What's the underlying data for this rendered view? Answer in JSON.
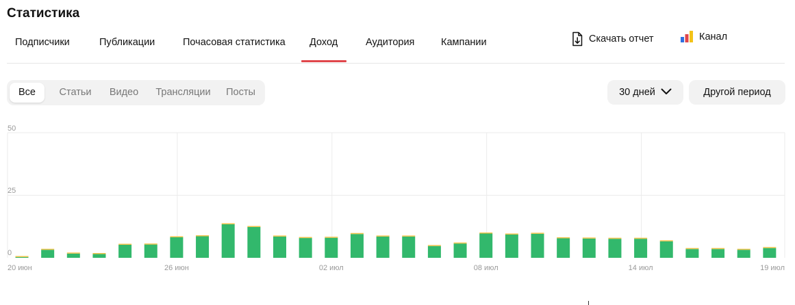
{
  "page": {
    "title": "Статистика"
  },
  "tabs": [
    {
      "label": "Подписчики",
      "active": false
    },
    {
      "label": "Публикации",
      "active": false
    },
    {
      "label": "Почасовая статистика",
      "active": false
    },
    {
      "label": "Доход",
      "active": true
    },
    {
      "label": "Аудитория",
      "active": false
    },
    {
      "label": "Кампании",
      "active": false
    }
  ],
  "actions": {
    "download_report": {
      "label": "Скачать отчет",
      "icon": "download-file-icon"
    },
    "channel": {
      "label": "Канал",
      "icon": "bar-chart-logo-icon"
    }
  },
  "content_filter": {
    "items": [
      "Все",
      "Статьи",
      "Видео",
      "Трансляции",
      "Посты"
    ],
    "active_index": 0
  },
  "period": {
    "selected": "30 дней",
    "other_label": "Другой период"
  },
  "colors": {
    "accent_tab": "#e0464b",
    "bar": "#32b86c",
    "bar_cap": "#f0c34a"
  },
  "chart_data": {
    "type": "bar",
    "ylim": [
      0,
      50
    ],
    "y_ticks": [
      "0",
      "25",
      "50"
    ],
    "x_ticks": [
      {
        "label": "20 июн",
        "index": 0
      },
      {
        "label": "26 июн",
        "index": 6
      },
      {
        "label": "02 июл",
        "index": 12
      },
      {
        "label": "08 июл",
        "index": 18
      },
      {
        "label": "14 июл",
        "index": 24
      },
      {
        "label": "19 июл",
        "index": 29
      }
    ],
    "categories": [
      "20 июн",
      "21 июн",
      "22 июн",
      "23 июн",
      "24 июн",
      "25 июн",
      "26 июн",
      "27 июн",
      "28 июн",
      "29 июн",
      "30 июн",
      "01 июл",
      "02 июл",
      "03 июл",
      "04 июл",
      "05 июл",
      "06 июл",
      "07 июл",
      "08 июл",
      "09 июл",
      "10 июл",
      "11 июл",
      "12 июл",
      "13 июл",
      "14 июл",
      "15 июл",
      "16 июл",
      "17 июл",
      "18 июл",
      "19 июл"
    ],
    "values": [
      0.3,
      3.2,
      1.7,
      1.5,
      5.2,
      5.3,
      8.2,
      8.6,
      13.4,
      12.3,
      8.5,
      7.9,
      8.0,
      9.5,
      8.5,
      8.5,
      4.7,
      5.7,
      9.7,
      9.3,
      9.6,
      7.8,
      7.7,
      7.6,
      7.6,
      6.6,
      3.5,
      3.5,
      3.2,
      3.9
    ],
    "grid": true,
    "legend": "none"
  }
}
